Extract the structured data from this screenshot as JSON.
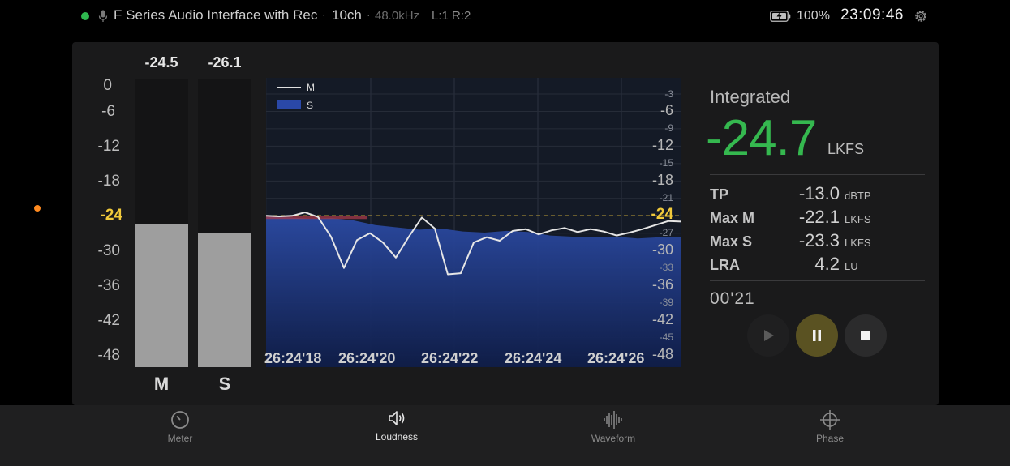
{
  "status": {
    "device": "F Series Audio Interface with Rec",
    "separator": "·",
    "channels": "10ch",
    "sample_rate": "48.0kHz",
    "io": "L:1 R:2",
    "battery": "100%",
    "time": "23:09:46",
    "indicator_color": "#2fb84f",
    "icons": [
      "mic-icon",
      "battery-charging-icon",
      "gear-icon"
    ]
  },
  "meters": {
    "scale": [
      "0",
      "-6",
      "-12",
      "-18",
      "-24",
      "-30",
      "-36",
      "-42",
      "-48"
    ],
    "target": "-24",
    "bars": [
      {
        "name": "M",
        "peak": "-24.5",
        "level": -24.5
      },
      {
        "name": "S",
        "peak": "-26.1",
        "level": -26.1
      }
    ]
  },
  "chart_data": {
    "type": "area",
    "legend": [
      "M",
      "S"
    ],
    "x_ticks": [
      "26:24'18",
      "26:24'20",
      "26:24'22",
      "26:24'24",
      "26:24'26"
    ],
    "y_ticks": [
      "-3",
      "-6",
      "-9",
      "-12",
      "-15",
      "-18",
      "-21",
      "-24",
      "-27",
      "-30",
      "-33",
      "-36",
      "-39",
      "-42",
      "-45",
      "-48"
    ],
    "target": -24,
    "target_label": "-24",
    "ylim": [
      -50,
      0
    ],
    "x_seconds": [
      0,
      0.5,
      1,
      1.5,
      2,
      2.5,
      3,
      3.5,
      4,
      4.5,
      5,
      5.5,
      6,
      6.5,
      7,
      7.5,
      8,
      8.5,
      9,
      9.5,
      10
    ],
    "series": [
      {
        "name": "M",
        "values": [
          -24,
          -24.1,
          -24,
          -23.4,
          -24.2,
          -27.6,
          -33,
          -28.2,
          -27,
          -28.6,
          -31.2,
          -27.6,
          -24.3,
          -26.2,
          -34.1,
          -33.9,
          -28.6,
          -27.7,
          -28.3,
          -26.6,
          -26.3,
          -27.2,
          -26.5,
          -26.1,
          -26.8,
          -26.3,
          -26.7,
          -27.4,
          -26.9,
          -26.3,
          -25.6,
          -24.9,
          -25.0
        ]
      },
      {
        "name": "S",
        "values": [
          -24.2,
          -24.3,
          -24.5,
          -24.4,
          -24.8,
          -25.6,
          -26.0,
          -26.4,
          -26.2,
          -26.7,
          -26.9,
          -26.6,
          -26.8,
          -27.4,
          -27.6,
          -27.7,
          -27.6,
          -27.9,
          -27.7,
          -27.6
        ]
      }
    ]
  },
  "readings": {
    "integrated_label": "Integrated",
    "integrated_value": "-24.7",
    "integrated_unit": "LKFS",
    "rows": [
      {
        "label": "TP",
        "value": "-13.0",
        "unit": "dBTP"
      },
      {
        "label": "Max M",
        "value": "-22.1",
        "unit": "LKFS"
      },
      {
        "label": "Max S",
        "value": "-23.3",
        "unit": "LKFS"
      },
      {
        "label": "LRA",
        "value": "4.2",
        "unit": "LU"
      }
    ],
    "elapsed": "00'21",
    "controls": [
      "play-icon",
      "pause-icon",
      "stop-icon"
    ],
    "pause_color": "#5a5222"
  },
  "nav": [
    {
      "label": "Meter",
      "icon": "meter-icon",
      "active": false
    },
    {
      "label": "Loudness",
      "icon": "speaker-icon",
      "active": true
    },
    {
      "label": "Waveform",
      "icon": "waveform-icon",
      "active": false
    },
    {
      "label": "Phase",
      "icon": "crosshair-icon",
      "active": false
    }
  ]
}
